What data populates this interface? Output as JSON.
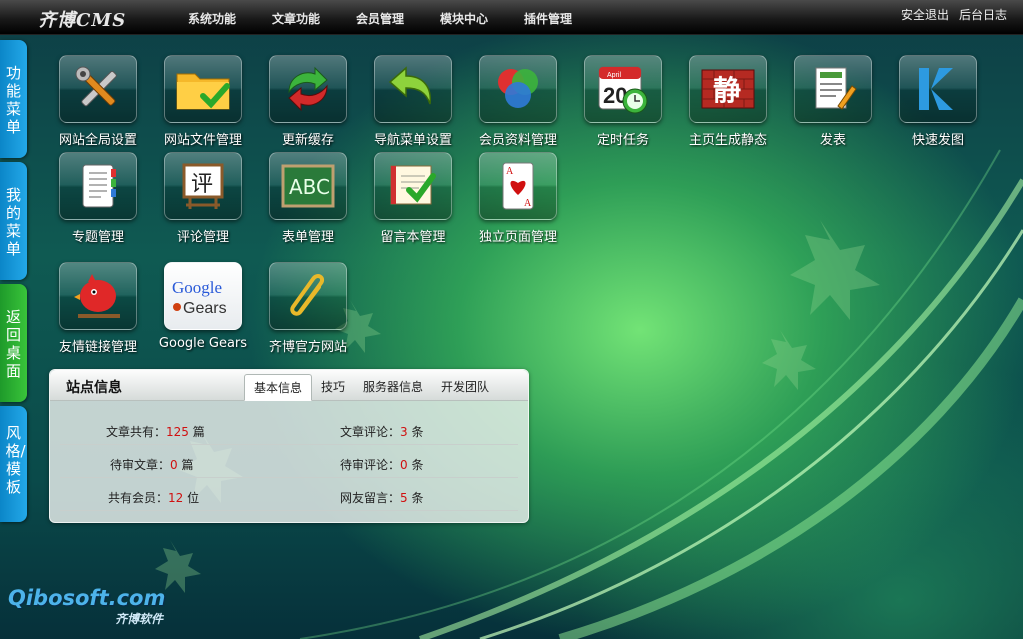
{
  "app": {
    "logo_text": "齐博CMS"
  },
  "nav": {
    "items": [
      "系统功能",
      "文章功能",
      "会员管理",
      "模块中心",
      "插件管理"
    ]
  },
  "toplinks": {
    "logout": "安全退出",
    "log": "后台日志"
  },
  "sidebar": {
    "tabs": [
      {
        "label": "功能菜单",
        "color": "#1a9ddc"
      },
      {
        "label": "我的菜单",
        "color": "#1a9ddc"
      },
      {
        "label": "返回桌面",
        "color": "#2db334"
      },
      {
        "label": "风格/模板",
        "color": "#1a9ddc"
      }
    ]
  },
  "icons": [
    {
      "label": "网站全局设置",
      "icon": "tools-icon"
    },
    {
      "label": "网站文件管理",
      "icon": "folder-check-icon"
    },
    {
      "label": "更新缓存",
      "icon": "refresh-arrows-icon"
    },
    {
      "label": "导航菜单设置",
      "icon": "undo-arrow-icon"
    },
    {
      "label": "会员资料管理",
      "icon": "users-circles-icon"
    },
    {
      "label": "定时任务",
      "icon": "calendar-clock-icon"
    },
    {
      "label": "主页生成静态",
      "icon": "static-brick-icon"
    },
    {
      "label": "发表",
      "icon": "document-pencil-icon"
    },
    {
      "label": "快速发图",
      "icon": "k-logo-icon"
    },
    {
      "label": "专题管理",
      "icon": "notebook-icon"
    },
    {
      "label": "评论管理",
      "icon": "comment-board-icon"
    },
    {
      "label": "表单管理",
      "icon": "chalkboard-icon"
    },
    {
      "label": "留言本管理",
      "icon": "guestbook-icon"
    },
    {
      "label": "独立页面管理",
      "icon": "playing-card-icon"
    },
    {
      "label": "友情链接管理",
      "icon": "red-bird-icon"
    },
    {
      "label": "Google Gears",
      "icon": "google-gears-icon"
    },
    {
      "label": "齐博官方网站",
      "icon": "paperclip-icon"
    }
  ],
  "calendar_icon": {
    "month": "April",
    "day": "20"
  },
  "static_icon_char": "静",
  "comment_icon_char": "评",
  "abc_icon_text": "ABC",
  "card_icon": {
    "rank": "A"
  },
  "google_icon": {
    "line1": "Google",
    "line2": "Gears"
  },
  "info_panel": {
    "title": "站点信息",
    "tabs": [
      "基本信息",
      "技巧",
      "服务器信息",
      "开发团队"
    ],
    "active_tab": "基本信息",
    "rows": [
      {
        "l_label": "文章共有：",
        "l_value": "125",
        "l_unit": " 篇",
        "r_label": "文章评论：",
        "r_value": "3",
        "r_unit": " 条"
      },
      {
        "l_label": "待审文章：",
        "l_value": "0",
        "l_unit": " 篇",
        "r_label": "待审评论：",
        "r_value": "0",
        "r_unit": " 条"
      },
      {
        "l_label": "共有会员：",
        "l_value": "12",
        "l_unit": " 位",
        "r_label": "网友留言：",
        "r_value": "5",
        "r_unit": " 条"
      }
    ]
  },
  "brand": {
    "main": "Qibosoft.com",
    "sub": "齐博软件"
  },
  "colors": {
    "accent_blue": "#1a9ddc",
    "accent_green": "#2db334",
    "number_red": "#d01010"
  }
}
